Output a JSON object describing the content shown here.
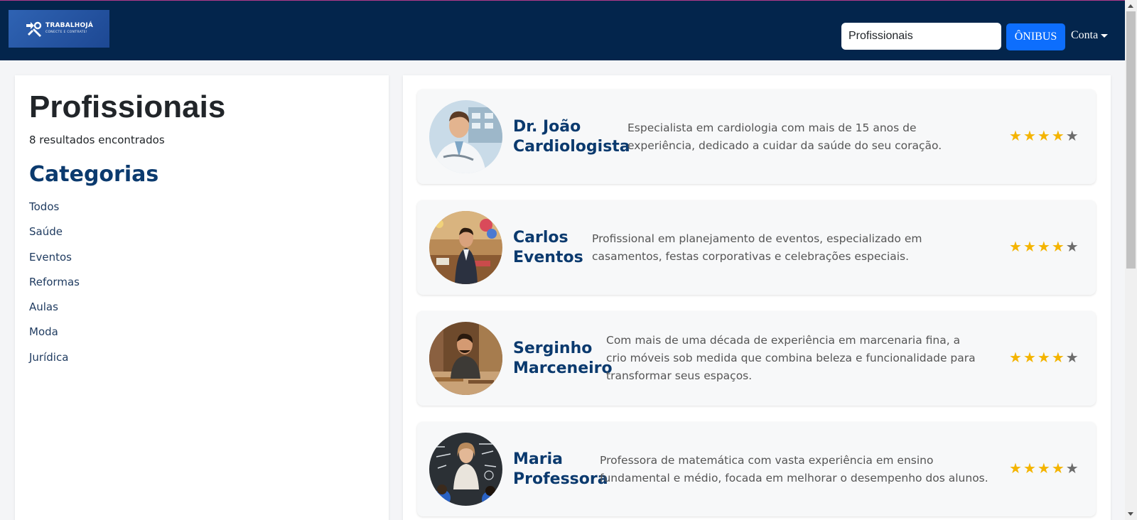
{
  "brand": {
    "name": "TRABALHOJÁ",
    "tagline": "CONECTE E CONTRATE!"
  },
  "nav": {
    "search_value": "Profissionais",
    "button_label": "ÔNIBUS",
    "account_label": "Conta"
  },
  "sidebar": {
    "title": "Profissionais",
    "results": "8 resultados encontrados",
    "categories_title": "Categorias",
    "categories": [
      "Todos",
      "Saúde",
      "Eventos",
      "Reformas",
      "Aulas",
      "Moda",
      "Jurídica"
    ]
  },
  "professionals": [
    {
      "name_line1": "Dr. João",
      "name_line2": "Cardiologista",
      "description": "Especialista em cardiologia com mais de 15 anos de experiência, dedicado a cuidar da saúde do seu coração.",
      "rating": 4,
      "max_rating": 5
    },
    {
      "name_line1": "Carlos",
      "name_line2": "Eventos",
      "description": "Profissional em planejamento de eventos, especializado em casamentos, festas corporativas e celebrações especiais.",
      "rating": 4,
      "max_rating": 5
    },
    {
      "name_line1": "Serginho",
      "name_line2": "Marceneiro",
      "description": "Com mais de uma década de experiência em marcenaria fina, a crio móveis sob medida que combina beleza e funcionalidade para transformar seus espaços.",
      "rating": 4,
      "max_rating": 5
    },
    {
      "name_line1": "Maria",
      "name_line2": "Professora",
      "description": "Professora de matemática com vasta experiência em ensino fundamental e médio, focada em melhorar o desempenho dos alunos.",
      "rating": 4,
      "max_rating": 5
    }
  ],
  "colors": {
    "navbar": "#03254c",
    "accent": "#0d6efd",
    "heading": "#0b3a6e",
    "star": "#f4b400"
  }
}
